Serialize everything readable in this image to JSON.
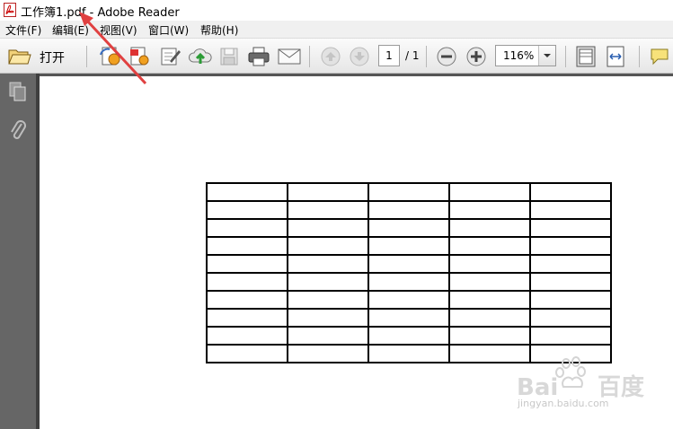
{
  "window": {
    "title": "工作簿1.pdf - Adobe Reader"
  },
  "menu": {
    "items": [
      {
        "label": "文件(F)"
      },
      {
        "label": "编辑(E)"
      },
      {
        "label": "视图(V)"
      },
      {
        "label": "窗口(W)"
      },
      {
        "label": "帮助(H)"
      }
    ]
  },
  "toolbar": {
    "open_label": "打开",
    "page_current": "1",
    "page_total": "/ 1",
    "zoom": "116%"
  },
  "table": {
    "rows": 10,
    "cols": 5
  },
  "watermark": {
    "text": "jingyan.baidu.com"
  }
}
